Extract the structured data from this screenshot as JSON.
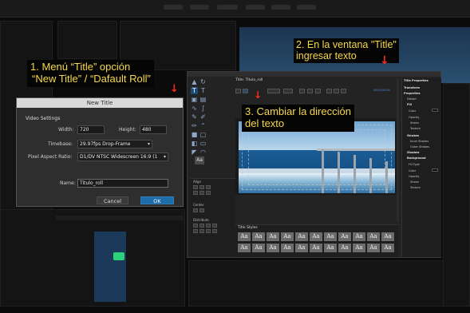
{
  "callouts": {
    "step1_line1": "1. Menú “Title” opción",
    "step1_line2": "“New Title” / “Dafault Roll”",
    "step2_line1": "2. En la ventana \"Title\"",
    "step2_line2": "ingresar texto",
    "step3_line1": "3. Cambiar la dirección",
    "step3_line2": "del texto",
    "arrow_glyph": "↓",
    "text_color": "#f6d84a",
    "arrow_color": "#ff2a1f"
  },
  "new_title_dialog": {
    "title": "New Title",
    "section": "Video Settings",
    "width_label": "Width:",
    "width_value": "720",
    "height_label": "Height:",
    "height_value": "480",
    "timebase_label": "Timebase:",
    "timebase_value": "29.97fps Drop-Frame",
    "par_label": "Pixel Aspect Ratio:",
    "par_value": "D1/DV NTSC Widescreen 16:9 (1",
    "name_label": "Name:",
    "name_value": "Titulo_roll",
    "cancel_label": "Cancel",
    "ok_label": "OK"
  },
  "title_window": {
    "tab_title": "Title: Titulo_roll",
    "timecode": "00;00;00;00",
    "align_label": "Align",
    "center_label": "Center",
    "distribute_label": "Distribute",
    "styles_title": "Title Styles",
    "style_glyph": "Aa",
    "tool_preview": "Aa",
    "properties": {
      "title": "Title Properties",
      "items": [
        "Transform",
        "Properties",
        "Distort",
        "Fill",
        "Color",
        "Opacity",
        "Sheen",
        "Texture",
        "Strokes",
        "Inner Strokes",
        "Outer Strokes",
        "Shadow",
        "Background",
        "Fill Type",
        "Color",
        "Opacity",
        "Sheen",
        "Texture"
      ]
    }
  }
}
